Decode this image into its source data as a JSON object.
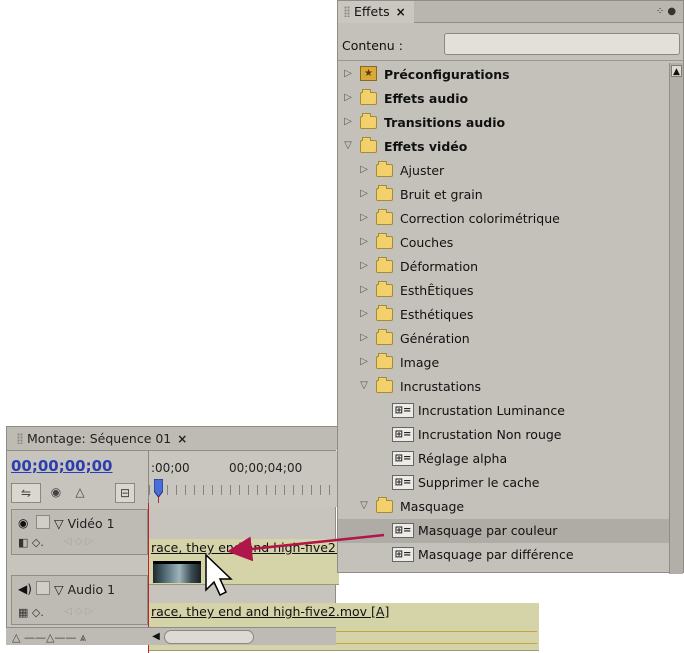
{
  "effects_panel": {
    "tab_label": "Effets",
    "close": "×",
    "menu_icon": "panel-menu-icon",
    "contents_label": "Contenu :",
    "search_value": "",
    "tree": [
      {
        "label": "Préconfigurations",
        "level": 0,
        "expanded": false,
        "bold": true,
        "icon": "preset-star-folder-icon"
      },
      {
        "label": "Effets audio",
        "level": 0,
        "expanded": false,
        "bold": true,
        "icon": "folder-icon"
      },
      {
        "label": "Transitions audio",
        "level": 0,
        "expanded": false,
        "bold": true,
        "icon": "folder-icon"
      },
      {
        "label": "Effets vidéo",
        "level": 0,
        "expanded": true,
        "bold": true,
        "icon": "folder-icon"
      },
      {
        "label": "Ajuster",
        "level": 1,
        "expanded": false,
        "icon": "folder-icon"
      },
      {
        "label": "Bruit et grain",
        "level": 1,
        "expanded": false,
        "icon": "folder-icon"
      },
      {
        "label": "Correction colorimétrique",
        "level": 1,
        "expanded": false,
        "icon": "folder-icon"
      },
      {
        "label": "Couches",
        "level": 1,
        "expanded": false,
        "icon": "folder-icon"
      },
      {
        "label": "Déformation",
        "level": 1,
        "expanded": false,
        "icon": "folder-icon"
      },
      {
        "label": "EsthÊtiques",
        "level": 1,
        "expanded": false,
        "icon": "folder-icon"
      },
      {
        "label": "Esthétiques",
        "level": 1,
        "expanded": false,
        "icon": "folder-icon"
      },
      {
        "label": "Génération",
        "level": 1,
        "expanded": false,
        "icon": "folder-icon"
      },
      {
        "label": "Image",
        "level": 1,
        "expanded": false,
        "icon": "folder-icon"
      },
      {
        "label": "Incrustations",
        "level": 1,
        "expanded": true,
        "icon": "folder-icon"
      },
      {
        "label": "Incrustation Luminance",
        "level": 2,
        "icon": "video-effect-icon"
      },
      {
        "label": "Incrustation Non rouge",
        "level": 2,
        "icon": "video-effect-icon"
      },
      {
        "label": "Réglage alpha",
        "level": 2,
        "icon": "video-effect-icon"
      },
      {
        "label": "Supprimer le cache",
        "level": 2,
        "icon": "video-effect-icon"
      },
      {
        "label": "Masquage",
        "level": 1,
        "expanded": true,
        "icon": "folder-icon"
      },
      {
        "label": "Masquage par couleur",
        "level": 2,
        "icon": "video-effect-icon",
        "selected": true
      },
      {
        "label": "Masquage par différence",
        "level": 2,
        "icon": "video-effect-icon"
      }
    ]
  },
  "timeline_panel": {
    "tab_label": "Montage: Séquence 01",
    "close": "×",
    "timecode": "00;00;00;00",
    "ruler_labels": [
      ":00;00",
      "00;00;04;00"
    ],
    "video_track": {
      "name": "Vidéo 1",
      "clip_label": "race, they end and high-five2."
    },
    "audio_track": {
      "name": "Audio 1",
      "clip_label": "race, they end and high-five2.mov [A]"
    }
  },
  "colors": {
    "accent_arrow": "#b0164a",
    "timecode": "#2a3eb0",
    "playhead": "#c0202a",
    "clip": "#d5d3a8"
  }
}
